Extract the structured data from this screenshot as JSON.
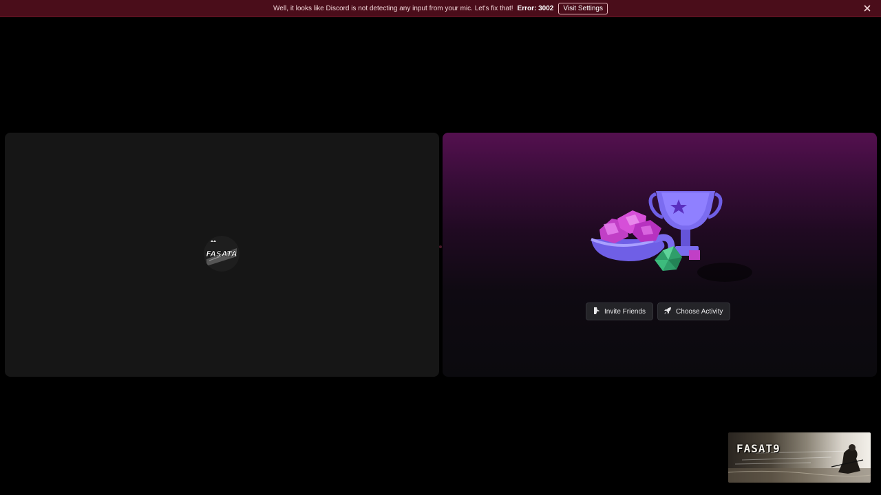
{
  "notice": {
    "message": "Well, it looks like Discord is not detecting any input from your mic. Let's fix that!",
    "error": "Error: 3002",
    "action_label": "Visit Settings",
    "close_icon": "close-icon",
    "background_color": "#4a0d1a"
  },
  "left_tile": {
    "avatar_text": "FASATA"
  },
  "activity_tile": {
    "invite_label": "Invite Friends",
    "invite_icon": "person-add-icon",
    "activity_label": "Choose Activity",
    "activity_icon": "rocket-icon",
    "accent_color": "#54104f"
  },
  "self_preview": {
    "name": "FASAT9"
  }
}
